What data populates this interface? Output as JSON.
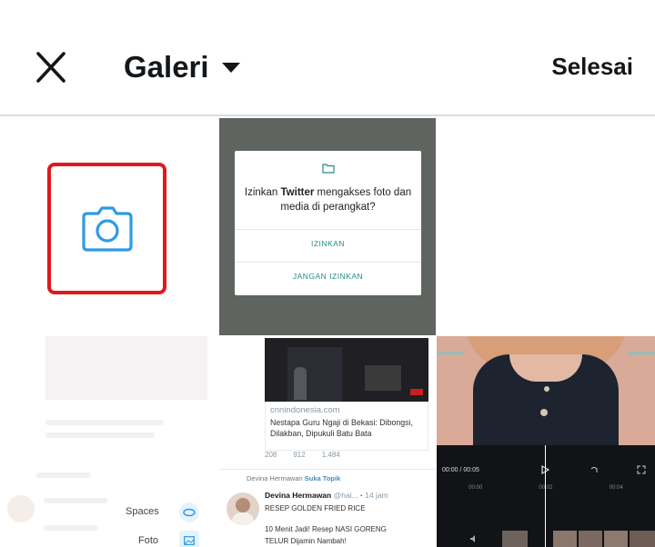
{
  "header": {
    "title": "Galeri",
    "done_label": "Selesai",
    "icons": {
      "close": "close-icon",
      "dropdown": "caret-down-icon"
    }
  },
  "tiles": {
    "camera": {
      "icon": "camera-icon",
      "highlight_color": "#e0191f",
      "icon_color": "#2f9be3"
    },
    "permission_dialog": {
      "message_before": "Izinkan ",
      "message_app": "Twitter",
      "message_after": " mengakses foto dan media di perangkat?",
      "allow_label": "IZINKAN",
      "deny_label": "JANGAN IZINKAN",
      "icon": "folder-icon"
    },
    "spaces_menu": {
      "items": [
        {
          "label": "Spaces",
          "icon": "spaces-icon"
        },
        {
          "label": "Foto",
          "icon": "photo-icon"
        }
      ]
    },
    "news_tweet": {
      "domain": "cnnindonesia.com",
      "headline": "Nestapa Guru Ngaji di Bekasi: Dibongsi, Dilakban, Dipukuli Batu Bata",
      "stats": [
        "208",
        "912",
        "1.484"
      ],
      "retweet_by": "Devina Hermawan",
      "retweet_suffix": "Suka Topik",
      "author_name": "Devina Hermawan",
      "author_handle": "@hai...",
      "time": "14 jam",
      "line1": "RESEP GOLDEN FRIED RICE",
      "line2": "10 Menit Jadi! Resep NASI GORENG",
      "line3": "TELUR Dijamin Nambah!"
    },
    "video_editor": {
      "time": "00:00 / 00:05",
      "marks": [
        "00:00",
        "00:02",
        "00:04"
      ]
    }
  }
}
